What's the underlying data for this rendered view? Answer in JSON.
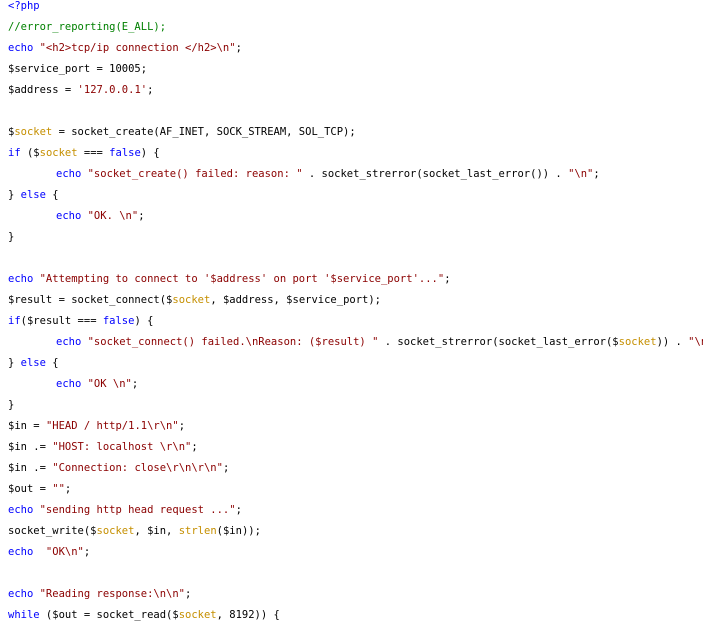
{
  "editor": {
    "lines": [
      {
        "parts": [
          {
            "t": "<?php",
            "c": "php"
          }
        ]
      },
      {
        "parts": [
          {
            "t": "//error_reporting(E_ALL);",
            "c": "comment"
          }
        ]
      },
      {
        "parts": [
          {
            "t": "echo ",
            "c": "kw"
          },
          {
            "t": "\"<h2>tcp/ip connection </h2>\\n\"",
            "c": "str"
          },
          {
            "t": ";",
            "c": "plain"
          }
        ]
      },
      {
        "parts": [
          {
            "t": "$service_port = 10005;",
            "c": "plain"
          }
        ]
      },
      {
        "parts": [
          {
            "t": "$address = ",
            "c": "plain"
          },
          {
            "t": "'127.0.0.1'",
            "c": "str"
          },
          {
            "t": ";",
            "c": "plain"
          }
        ]
      },
      {
        "parts": [
          {
            "t": "",
            "c": "plain"
          }
        ]
      },
      {
        "parts": [
          {
            "t": "$",
            "c": "plain"
          },
          {
            "t": "socket",
            "c": "var-socket"
          },
          {
            "t": " = socket_create(AF_INET, SOCK_STREAM, SOL_TCP);",
            "c": "plain"
          }
        ]
      },
      {
        "parts": [
          {
            "t": "if",
            "c": "kw"
          },
          {
            "t": " ($",
            "c": "plain"
          },
          {
            "t": "socket",
            "c": "var-socket"
          },
          {
            "t": " === ",
            "c": "plain"
          },
          {
            "t": "false",
            "c": "kw"
          },
          {
            "t": ") {",
            "c": "plain"
          }
        ]
      },
      {
        "indent": 1,
        "parts": [
          {
            "t": "echo ",
            "c": "kw"
          },
          {
            "t": "\"socket_create() failed: reason: \"",
            "c": "str"
          },
          {
            "t": " . socket_strerror(socket_last_error()) . ",
            "c": "plain"
          },
          {
            "t": "\"\\n\"",
            "c": "str"
          },
          {
            "t": ";",
            "c": "plain"
          }
        ]
      },
      {
        "parts": [
          {
            "t": "} ",
            "c": "plain"
          },
          {
            "t": "else",
            "c": "kw"
          },
          {
            "t": " {",
            "c": "plain"
          }
        ]
      },
      {
        "indent": 1,
        "parts": [
          {
            "t": "echo ",
            "c": "kw"
          },
          {
            "t": "\"OK. \\n\"",
            "c": "str"
          },
          {
            "t": ";",
            "c": "plain"
          }
        ]
      },
      {
        "parts": [
          {
            "t": "}",
            "c": "plain"
          }
        ]
      },
      {
        "parts": [
          {
            "t": "",
            "c": "plain"
          }
        ]
      },
      {
        "parts": [
          {
            "t": "echo ",
            "c": "kw"
          },
          {
            "t": "\"Attempting to connect to '$address' on port '$service_port'...\"",
            "c": "str"
          },
          {
            "t": ";",
            "c": "plain"
          }
        ]
      },
      {
        "parts": [
          {
            "t": "$result = socket_connect($",
            "c": "plain"
          },
          {
            "t": "socket",
            "c": "var-socket"
          },
          {
            "t": ", $address, $service_port);",
            "c": "plain"
          }
        ]
      },
      {
        "parts": [
          {
            "t": "if",
            "c": "kw"
          },
          {
            "t": "($result === ",
            "c": "plain"
          },
          {
            "t": "false",
            "c": "kw"
          },
          {
            "t": ") {",
            "c": "plain"
          }
        ]
      },
      {
        "indent": 1,
        "parts": [
          {
            "t": "echo ",
            "c": "kw"
          },
          {
            "t": "\"socket_connect() failed.\\nReason: ($result) \"",
            "c": "str"
          },
          {
            "t": " . socket_strerror(socket_last_error($",
            "c": "plain"
          },
          {
            "t": "socket",
            "c": "var-socket"
          },
          {
            "t": ")) . ",
            "c": "plain"
          },
          {
            "t": "\"\\n\"",
            "c": "str"
          },
          {
            "t": ";",
            "c": "plain"
          }
        ]
      },
      {
        "parts": [
          {
            "t": "} ",
            "c": "plain"
          },
          {
            "t": "else",
            "c": "kw"
          },
          {
            "t": " {",
            "c": "plain"
          }
        ]
      },
      {
        "indent": 1,
        "parts": [
          {
            "t": "echo ",
            "c": "kw"
          },
          {
            "t": "\"OK \\n\"",
            "c": "str"
          },
          {
            "t": ";",
            "c": "plain"
          }
        ]
      },
      {
        "parts": [
          {
            "t": "}",
            "c": "plain"
          }
        ]
      },
      {
        "parts": [
          {
            "t": "$in = ",
            "c": "plain"
          },
          {
            "t": "\"HEAD / http/1.1\\r\\n\"",
            "c": "str"
          },
          {
            "t": ";",
            "c": "plain"
          }
        ]
      },
      {
        "parts": [
          {
            "t": "$in .= ",
            "c": "plain"
          },
          {
            "t": "\"HOST: localhost \\r\\n\"",
            "c": "str"
          },
          {
            "t": ";",
            "c": "plain"
          }
        ]
      },
      {
        "parts": [
          {
            "t": "$in .= ",
            "c": "plain"
          },
          {
            "t": "\"Connection: close\\r\\n\\r\\n\"",
            "c": "str"
          },
          {
            "t": ";",
            "c": "plain"
          }
        ]
      },
      {
        "parts": [
          {
            "t": "$out = ",
            "c": "plain"
          },
          {
            "t": "\"\"",
            "c": "str"
          },
          {
            "t": ";",
            "c": "plain"
          }
        ]
      },
      {
        "parts": [
          {
            "t": "echo ",
            "c": "kw"
          },
          {
            "t": "\"sending http head request ...\"",
            "c": "str"
          },
          {
            "t": ";",
            "c": "plain"
          }
        ]
      },
      {
        "parts": [
          {
            "t": "socket_write($",
            "c": "plain"
          },
          {
            "t": "socket",
            "c": "var-socket"
          },
          {
            "t": ", $in, ",
            "c": "plain"
          },
          {
            "t": "strlen",
            "c": "fn-yellow"
          },
          {
            "t": "($in));",
            "c": "plain"
          }
        ]
      },
      {
        "parts": [
          {
            "t": "echo ",
            "c": "kw"
          },
          {
            "t": " \"OK\\n\"",
            "c": "str"
          },
          {
            "t": ";",
            "c": "plain"
          }
        ]
      },
      {
        "parts": [
          {
            "t": "",
            "c": "plain"
          }
        ]
      },
      {
        "parts": [
          {
            "t": "echo ",
            "c": "kw"
          },
          {
            "t": "\"Reading response:\\n\\n\"",
            "c": "str"
          },
          {
            "t": ";",
            "c": "plain"
          }
        ]
      },
      {
        "parts": [
          {
            "t": "while",
            "c": "kw"
          },
          {
            "t": " ($out = socket_read($",
            "c": "plain"
          },
          {
            "t": "socket",
            "c": "var-socket"
          },
          {
            "t": ", 8192)) {",
            "c": "plain"
          }
        ]
      }
    ]
  }
}
